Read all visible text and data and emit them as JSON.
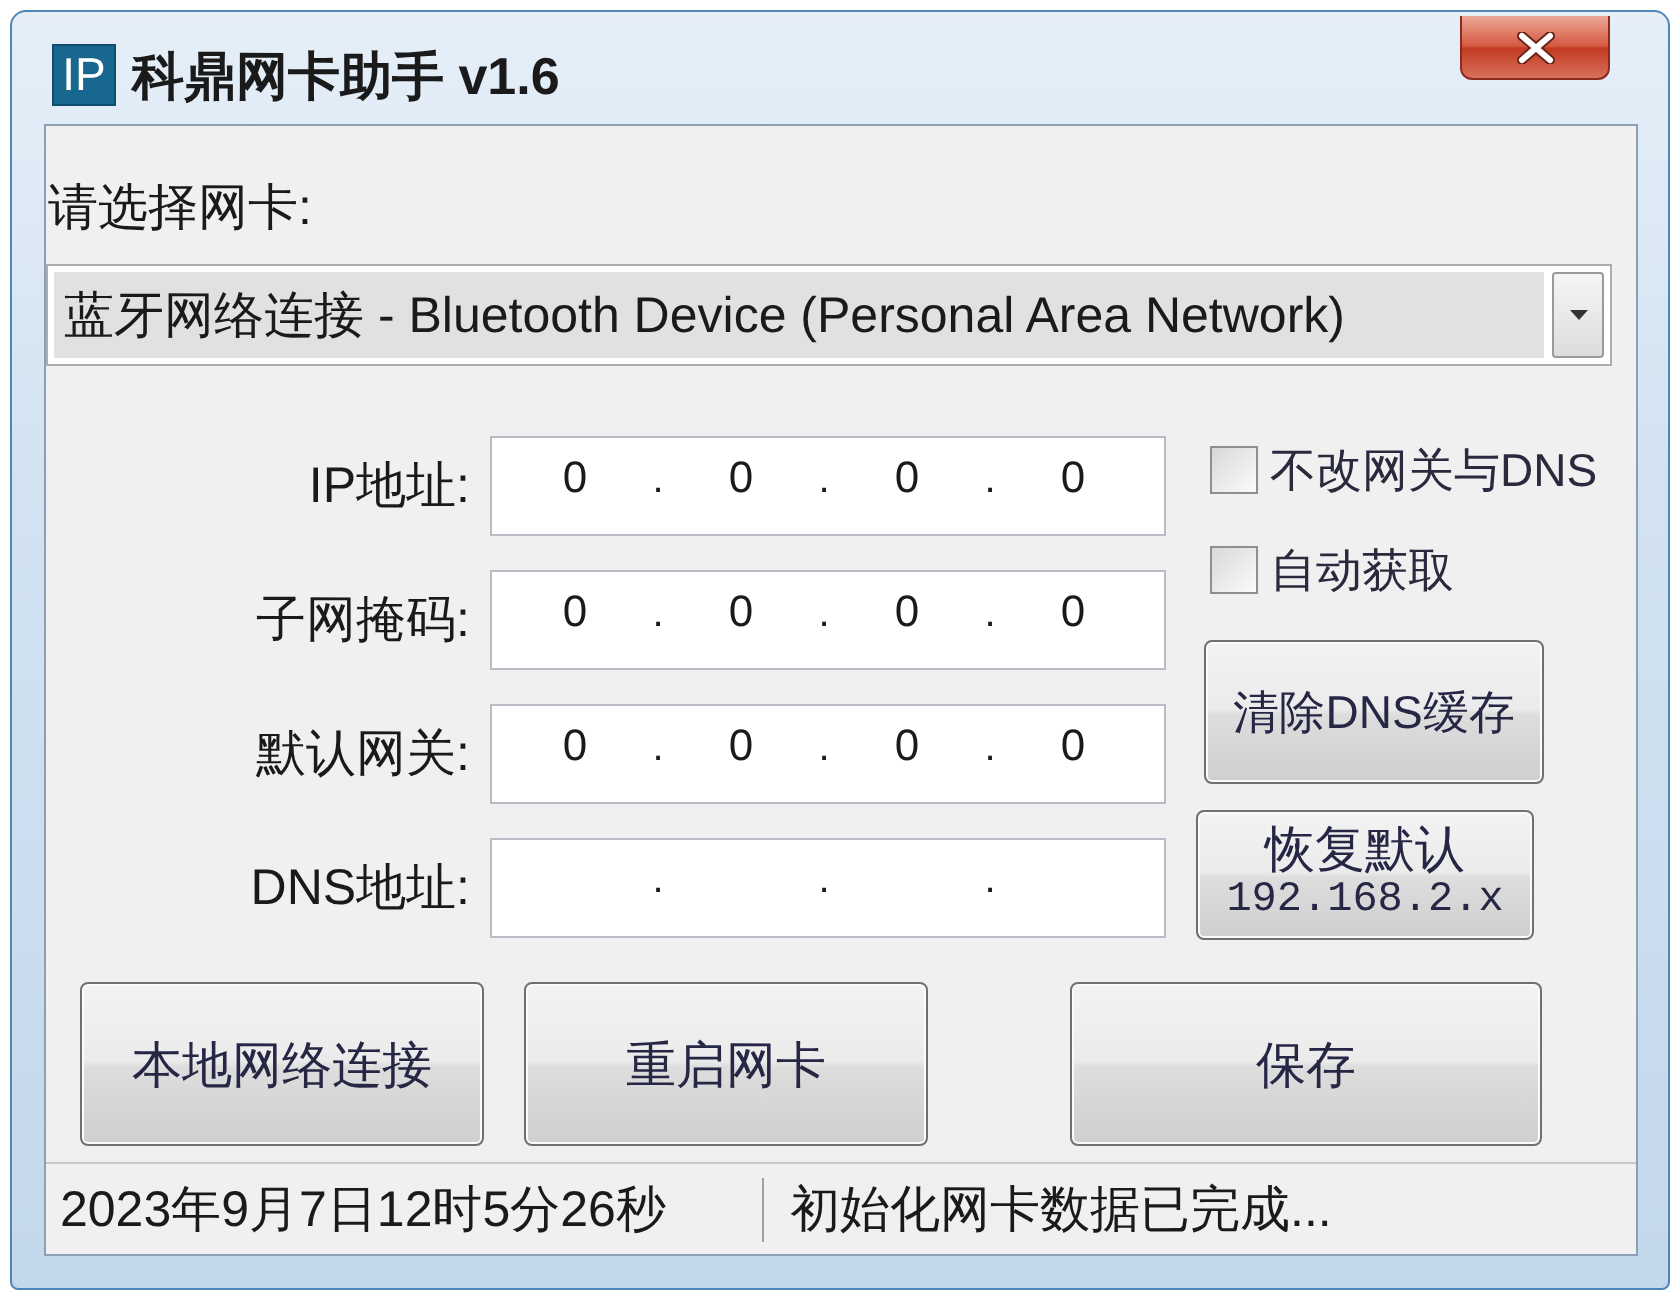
{
  "window": {
    "icon_text": "IP",
    "title": "科鼎网卡助手 v1.6"
  },
  "adapter": {
    "label": "请选择网卡:",
    "value": "蓝牙网络连接 - Bluetooth Device (Personal Area Network)"
  },
  "address_fields": [
    {
      "label": "IP地址:",
      "octets": [
        "0",
        "0",
        "0",
        "0"
      ],
      "dots": [
        ".",
        ".",
        "."
      ]
    },
    {
      "label": "子网掩码:",
      "octets": [
        "0",
        "0",
        "0",
        "0"
      ],
      "dots": [
        ".",
        ".",
        "."
      ]
    },
    {
      "label": "默认网关:",
      "octets": [
        "0",
        "0",
        "0",
        "0"
      ],
      "dots": [
        ".",
        ".",
        "."
      ]
    },
    {
      "label": "DNS地址:",
      "dots": [
        ".",
        ".",
        "."
      ]
    }
  ],
  "options": [
    {
      "label": "不改网关与DNS",
      "checked": false
    },
    {
      "label": "自动获取",
      "checked": false
    }
  ],
  "clear_dns_button": {
    "label": "清除DNS缓存"
  },
  "restore_button": {
    "label": "恢复默认",
    "detail": "192.168.2.x"
  },
  "bottom_buttons": [
    {
      "label": "本地网络连接"
    },
    {
      "label": "重启网卡"
    },
    {
      "label": "保存"
    }
  ],
  "status_bar": {
    "time": "2023年9月7日12时5分26秒",
    "message": "初始化网卡数据已完成..."
  }
}
